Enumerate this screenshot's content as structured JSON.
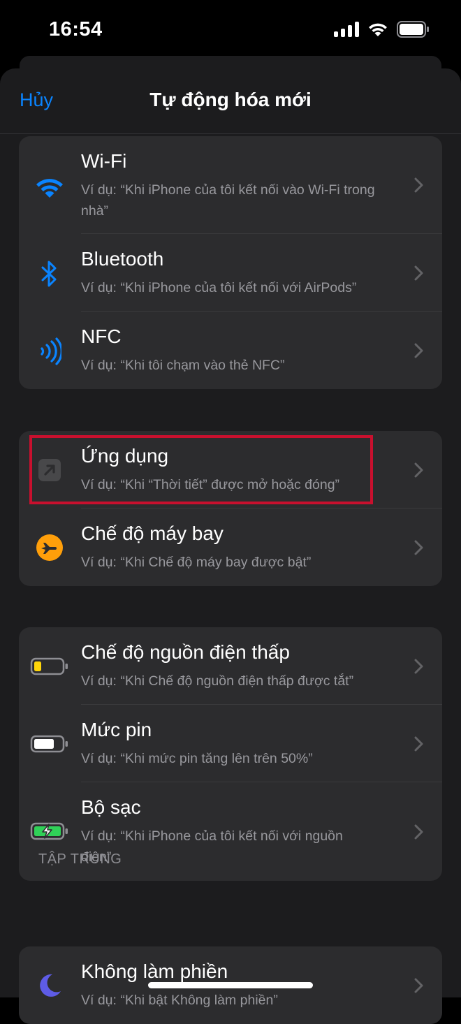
{
  "status_bar": {
    "time": "16:54"
  },
  "nav": {
    "cancel_label": "Hủy",
    "title": "Tự động hóa mới"
  },
  "group1": [
    {
      "title": "Wi-Fi",
      "subtitle": "Ví dụ: “Khi iPhone của tôi kết nối vào Wi-Fi trong nhà”",
      "icon": "wifi-icon"
    },
    {
      "title": "Bluetooth",
      "subtitle": "Ví dụ: “Khi iPhone của tôi kết nối với AirPods”",
      "icon": "bluetooth-icon"
    },
    {
      "title": "NFC",
      "subtitle": "Ví dụ: “Khi tôi chạm vào thẻ NFC”",
      "icon": "nfc-icon"
    }
  ],
  "group2": [
    {
      "title": "Ứng dụng",
      "subtitle": "Ví dụ: “Khi “Thời tiết” được mở hoặc đóng”",
      "icon": "app-arrow-icon"
    },
    {
      "title": "Chế độ máy bay",
      "subtitle": "Ví dụ: “Khi Chế độ máy bay được bật”",
      "icon": "airplane-icon"
    }
  ],
  "group3": [
    {
      "title": "Chế độ nguồn điện thấp",
      "subtitle": "Ví dụ: “Khi Chế độ nguồn điện thấp được tắt”",
      "icon": "low-battery-icon"
    },
    {
      "title": "Mức pin",
      "subtitle": "Ví dụ: “Khi mức pin tăng lên trên 50%”",
      "icon": "battery-icon"
    },
    {
      "title": "Bộ sạc",
      "subtitle": "Ví dụ: “Khi iPhone của tôi kết nối với nguồn điện”",
      "icon": "charging-battery-icon"
    }
  ],
  "section_focus": {
    "header": "TẬP TRUNG",
    "items": [
      {
        "title": "Không làm phiền",
        "subtitle": "Ví dụ: “Khi bật Không làm phiền”",
        "icon": "moon-icon"
      }
    ]
  },
  "colors": {
    "accent": "#0a84ff",
    "orange": "#ff9f0a",
    "yellow": "#ffd60a",
    "green": "#30d158",
    "purple": "#5e5ce6",
    "highlight": "#c8102e"
  }
}
